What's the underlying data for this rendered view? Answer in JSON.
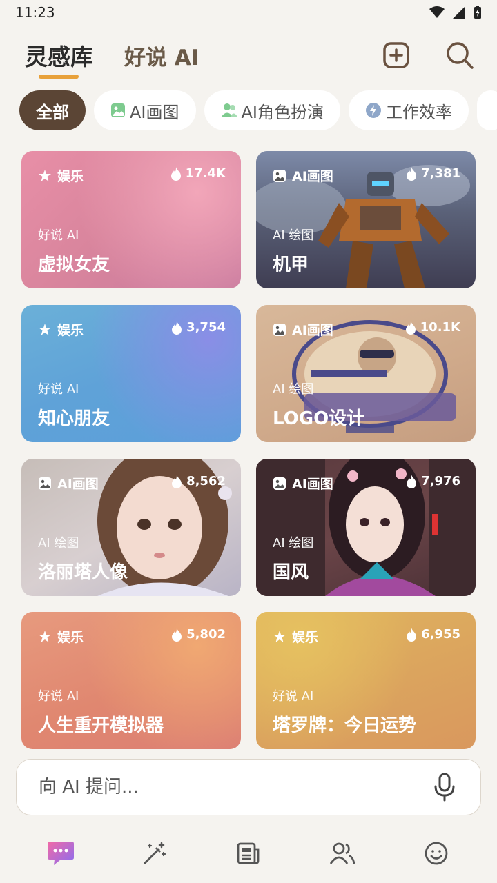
{
  "status_bar": {
    "time": "11:23"
  },
  "header": {
    "tab_active": "灵感库",
    "tab_secondary": "好说 AI"
  },
  "chips": [
    {
      "label": "全部",
      "active": true,
      "icon": ""
    },
    {
      "label": "AI画图",
      "active": false,
      "icon": "image-icon"
    },
    {
      "label": "AI角色扮演",
      "active": false,
      "icon": "people-icon"
    },
    {
      "label": "工作效率",
      "active": false,
      "icon": "bolt-icon"
    }
  ],
  "cards": [
    {
      "tag": "娱乐",
      "tag_icon": "star-icon",
      "heat": "17.4K",
      "sub": "好说 AI",
      "title": "虚拟女友"
    },
    {
      "tag": "AI画图",
      "tag_icon": "image-icon",
      "heat": "7,381",
      "sub": "AI 绘图",
      "title": "机甲"
    },
    {
      "tag": "娱乐",
      "tag_icon": "star-icon",
      "heat": "3,754",
      "sub": "好说 AI",
      "title": "知心朋友"
    },
    {
      "tag": "AI画图",
      "tag_icon": "image-icon",
      "heat": "10.1K",
      "sub": "AI 绘图",
      "title": "LOGO设计"
    },
    {
      "tag": "AI画图",
      "tag_icon": "image-icon",
      "heat": "8,562",
      "sub": "AI 绘图",
      "title": "洛丽塔人像"
    },
    {
      "tag": "AI画图",
      "tag_icon": "image-icon",
      "heat": "7,976",
      "sub": "AI 绘图",
      "title": "国风"
    },
    {
      "tag": "娱乐",
      "tag_icon": "star-icon",
      "heat": "5,802",
      "sub": "好说 AI",
      "title": "人生重开模拟器"
    },
    {
      "tag": "娱乐",
      "tag_icon": "star-icon",
      "heat": "6,955",
      "sub": "好说 AI",
      "title": "塔罗牌：今日运势"
    }
  ],
  "input": {
    "placeholder": "向 AI 提问..."
  },
  "bottom_nav": [
    {
      "icon": "chat-icon",
      "active": true
    },
    {
      "icon": "magic-wand-icon",
      "active": false
    },
    {
      "icon": "news-icon",
      "active": false
    },
    {
      "icon": "users-icon",
      "active": false
    },
    {
      "icon": "smile-icon",
      "active": false
    }
  ],
  "colors": {
    "accent": "#e8a13a",
    "chip_active": "#5b4535",
    "background": "#f5f3ef"
  }
}
